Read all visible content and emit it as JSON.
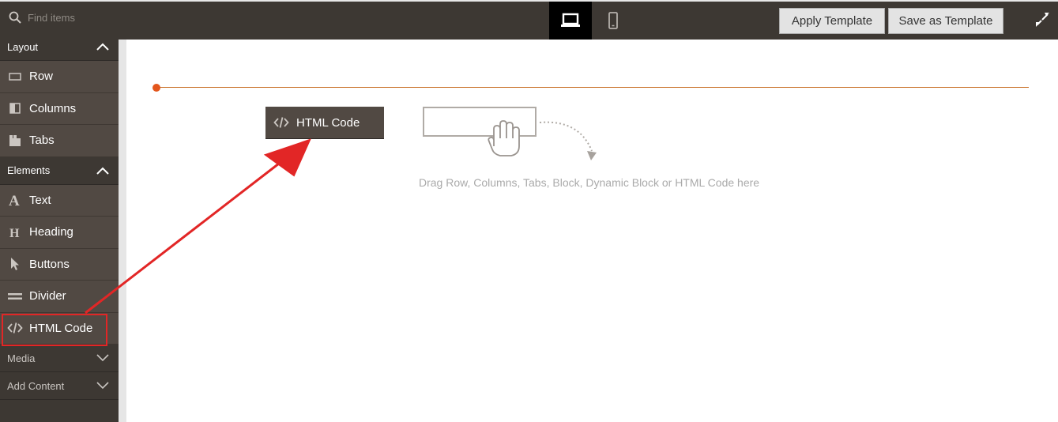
{
  "search": {
    "placeholder": "Find items"
  },
  "toolbar": {
    "apply_label": "Apply Template",
    "save_label": "Save as Template",
    "device_selected": "desktop"
  },
  "sidebar": {
    "groups": [
      {
        "title": "Layout",
        "expanded": true,
        "items": [
          {
            "label": "Row",
            "icon": "row-icon"
          },
          {
            "label": "Columns",
            "icon": "columns-icon"
          },
          {
            "label": "Tabs",
            "icon": "tabs-icon"
          }
        ]
      },
      {
        "title": "Elements",
        "expanded": true,
        "items": [
          {
            "label": "Text",
            "icon": "text-icon"
          },
          {
            "label": "Heading",
            "icon": "heading-icon"
          },
          {
            "label": "Buttons",
            "icon": "pointer-icon"
          },
          {
            "label": "Divider",
            "icon": "divider-icon"
          },
          {
            "label": "HTML Code",
            "icon": "code-icon",
            "highlighted": true
          }
        ]
      },
      {
        "title": "Media",
        "expanded": false,
        "items": []
      },
      {
        "title": "Add Content",
        "expanded": false,
        "items": []
      }
    ]
  },
  "stage": {
    "dragged_item_label": "HTML Code",
    "drop_hint": "Drag Row, Columns, Tabs, Block, Dynamic Block or HTML Code here"
  },
  "colors": {
    "sidebar_bg": "#514943",
    "topbar_bg": "#3d3833",
    "row_line": "#c76b1f",
    "annotation_red": "#e22626"
  }
}
